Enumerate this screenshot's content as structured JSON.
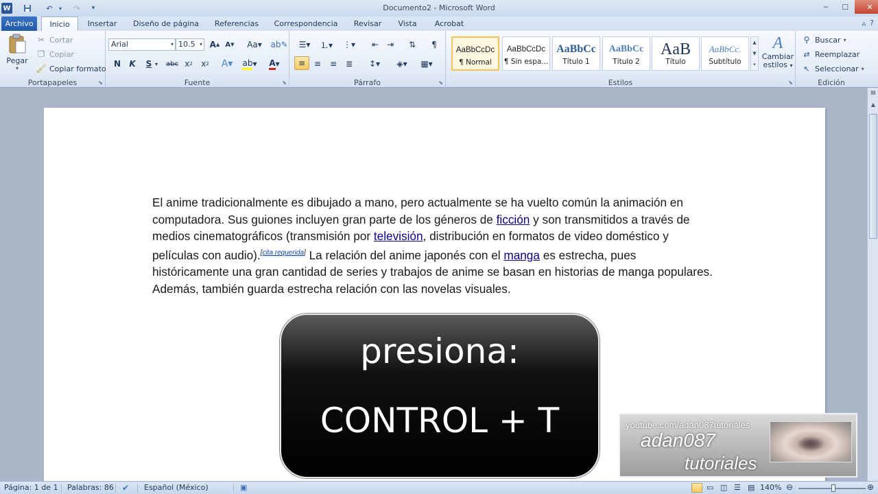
{
  "window": {
    "title": "Documento2 - Microsoft Word",
    "controls": [
      "─",
      "☐",
      "✕"
    ]
  },
  "qat": {
    "app_icon": "W",
    "icons": [
      "word-app-icon",
      "save-icon",
      "undo-icon",
      "redo-icon",
      "customize-icon"
    ]
  },
  "tabs": [
    {
      "label": "Archivo"
    },
    {
      "label": "Inicio"
    },
    {
      "label": "Insertar"
    },
    {
      "label": "Diseño de página"
    },
    {
      "label": "Referencias"
    },
    {
      "label": "Correspondencia"
    },
    {
      "label": "Revisar"
    },
    {
      "label": "Vista"
    },
    {
      "label": "Acrobat"
    }
  ],
  "clipboard": {
    "label": "Portapapeles",
    "paste": "Pegar",
    "cut": "Cortar",
    "copy": "Copiar",
    "format_painter": "Copiar formato"
  },
  "font": {
    "label": "Fuente",
    "family": "Arial",
    "size": "10.5"
  },
  "paragraph": {
    "label": "Párrafo"
  },
  "styles": {
    "label": "Estilos",
    "items": [
      {
        "sample": "AaBbCcDc",
        "name": "¶ Normal"
      },
      {
        "sample": "AaBbCcDc",
        "name": "¶ Sin espa..."
      },
      {
        "sample": "AaBbCc",
        "name": "Título 1"
      },
      {
        "sample": "AaBbCc",
        "name": "Título 2"
      },
      {
        "sample": "AaB",
        "name": "Título"
      },
      {
        "sample": "AaBbCc.",
        "name": "Subtítulo"
      }
    ],
    "change_styles_line1": "Cambiar",
    "change_styles_line2": "estilos"
  },
  "editing": {
    "label": "Edición",
    "find": "Buscar",
    "replace": "Reemplazar",
    "select": "Seleccionar"
  },
  "document": {
    "p1": "El anime tradicionalmente es dibujado a mano, pero actualmente se ha vuelto común la animación en computadora. Sus guiones incluyen gran parte de los géneros de ",
    "link1": "ficción",
    "p2": " y son transmitidos a través de medios cinematográficos (transmisión por ",
    "link2": "televisión",
    "p3": ", distribución en formatos de video doméstico y películas con audio).",
    "cite_open": "[",
    "cite": "cita requerida",
    "cite_close": "]",
    "p4": " La relación del anime japonés con el ",
    "link3": "manga",
    "p5": " es estrecha, pues históricamente una gran cantidad de series y trabajos de anime se basan en historias de manga populares. Además, también guarda estrecha relación con las novelas visuales."
  },
  "overlay": {
    "line1": "presiona:",
    "line2": "CONTROL + T"
  },
  "watermark": {
    "url": "youtube.com/adan087tutoriales",
    "name": "adan087",
    "sub": "tutoriales"
  },
  "status": {
    "page": "Página: 1 de 1",
    "words": "Palabras: 86",
    "language": "Español (México)",
    "zoom": "140%"
  },
  "colors": {
    "accent": "#2b579a",
    "ribbon_bg": "#e4ecf7",
    "workspace": "#abb7c8",
    "link": "#0b0080"
  }
}
